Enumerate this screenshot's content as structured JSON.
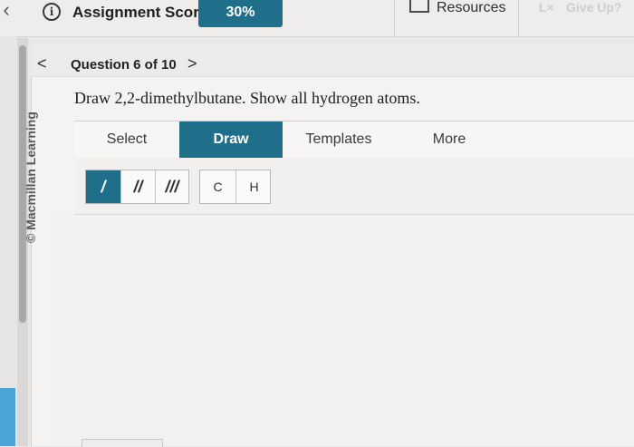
{
  "topbar": {
    "back_icon": "‹",
    "info_icon": "i",
    "score_label": "Assignment Score:",
    "score_value": "30%",
    "resources_label": "Resources",
    "giveup_icon": "L×",
    "giveup_label": "Give Up?"
  },
  "question": {
    "prev_icon": "<",
    "counter": "Question 6 of 10",
    "next_icon": ">",
    "prompt": "Draw 2,2-dimethylbutane. Show all hydrogen atoms."
  },
  "watermark": "© Macmillan Learning",
  "toolbar": {
    "tabs": [
      {
        "label": "Select",
        "active": false
      },
      {
        "label": "Draw",
        "active": true
      },
      {
        "label": "Templates",
        "active": false
      },
      {
        "label": "More",
        "active": false
      }
    ]
  },
  "draw_tools": {
    "bonds": [
      {
        "name": "single-bond",
        "label": "/",
        "active": true
      },
      {
        "name": "double-bond",
        "label": "//",
        "active": false
      },
      {
        "name": "triple-bond",
        "label": "///",
        "active": false
      }
    ],
    "atoms": [
      {
        "name": "carbon",
        "label": "C"
      },
      {
        "name": "hydrogen",
        "label": "H"
      }
    ]
  },
  "colors": {
    "accent": "#1f6f8b",
    "side_accent": "#4aa4d8"
  }
}
